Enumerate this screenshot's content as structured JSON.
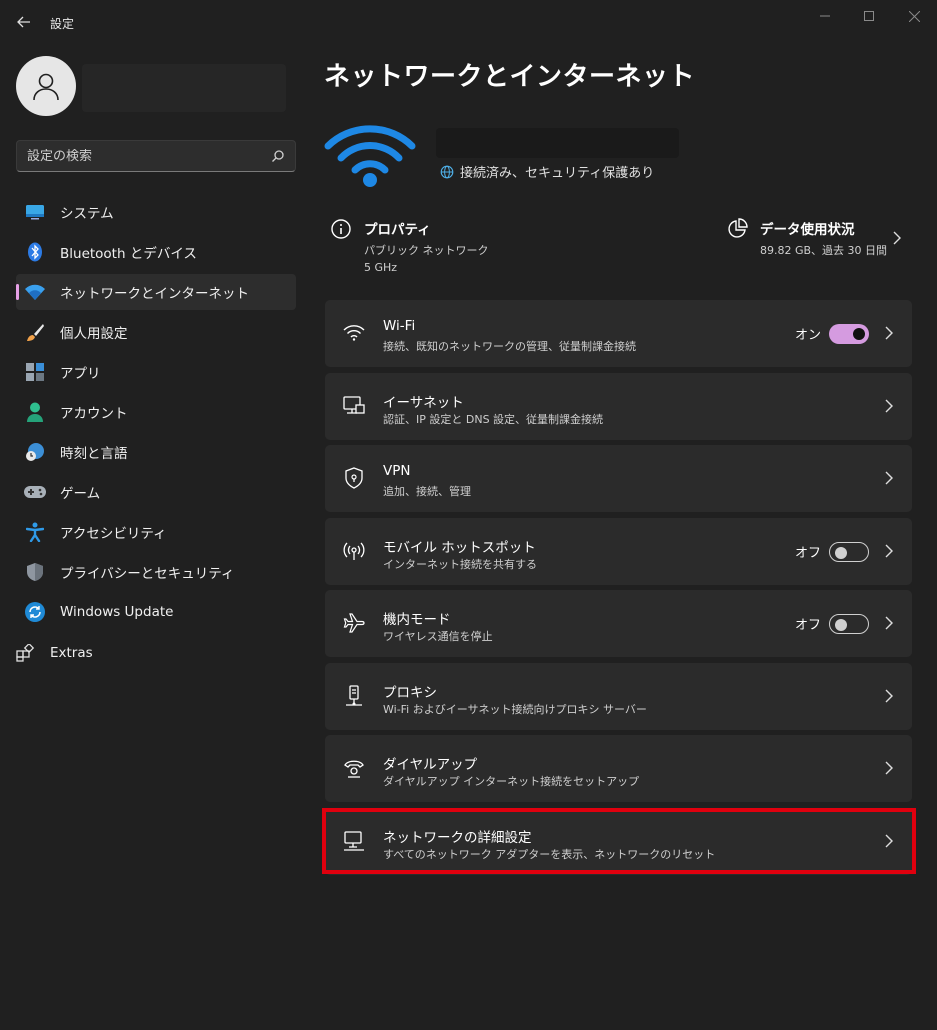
{
  "app": {
    "title": "設定"
  },
  "search": {
    "placeholder": "設定の検索"
  },
  "nav": {
    "items": [
      {
        "label": "システム"
      },
      {
        "label": "Bluetooth とデバイス"
      },
      {
        "label": "ネットワークとインターネット"
      },
      {
        "label": "個人用設定"
      },
      {
        "label": "アプリ"
      },
      {
        "label": "アカウント"
      },
      {
        "label": "時刻と言語"
      },
      {
        "label": "ゲーム"
      },
      {
        "label": "アクセシビリティ"
      },
      {
        "label": "プライバシーとセキュリティ"
      },
      {
        "label": "Windows Update"
      }
    ],
    "extras_label": "Extras"
  },
  "page": {
    "title": "ネットワークとインターネット",
    "status": "接続済み、セキュリティ保護あり",
    "properties": {
      "title": "プロパティ",
      "line1": "パブリック ネットワーク",
      "line2": "5 GHz"
    },
    "data_usage": {
      "title": "データ使用状況",
      "sub": "89.82 GB、過去 30 日間"
    }
  },
  "cards": [
    {
      "title": "Wi-Fi",
      "sub": "接続、既知のネットワークの管理、従量制課金接続",
      "toggle": "オン"
    },
    {
      "title": "イーサネット",
      "sub": "認証、IP 設定と DNS 設定、従量制課金接続"
    },
    {
      "title": "VPN",
      "sub": "追加、接続、管理"
    },
    {
      "title": "モバイル ホットスポット",
      "sub": "インターネット接続を共有する",
      "toggle": "オフ"
    },
    {
      "title": "機内モード",
      "sub": "ワイヤレス通信を停止",
      "toggle": "オフ"
    },
    {
      "title": "プロキシ",
      "sub": "Wi-Fi およびイーサネット接続向けプロキシ サーバー"
    },
    {
      "title": "ダイヤルアップ",
      "sub": "ダイヤルアップ インターネット接続をセットアップ"
    },
    {
      "title": "ネットワークの詳細設定",
      "sub": "すべてのネットワーク アダプターを表示、ネットワークのリセット"
    }
  ],
  "colors": {
    "accent": "#d59be0",
    "wifi_blue": "#1e88e5",
    "highlight": "#e0000e"
  }
}
